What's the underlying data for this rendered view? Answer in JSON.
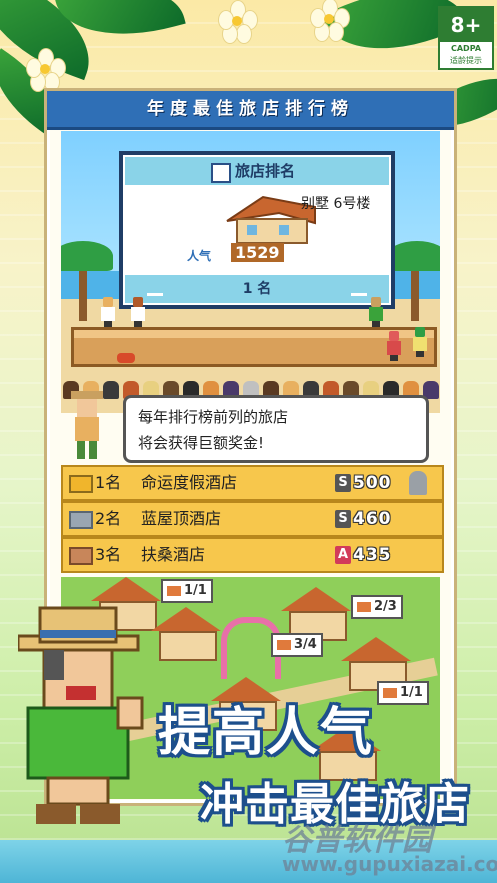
{
  "age_rating": {
    "value": "8+",
    "org": "CADPA",
    "caption": "适龄提示"
  },
  "panel": {
    "banner_title": "年度最佳旅店排行榜"
  },
  "billboard": {
    "title": "旅店排名",
    "hotel_name": "别墅 6号楼",
    "popularity_label": "人气",
    "popularity_value": "1529",
    "rank": "1 名"
  },
  "speech": {
    "line1": "每年排行榜前列的旅店",
    "line2": "将会获得巨额奖金!"
  },
  "rankings": [
    {
      "position": "1名",
      "name": "命运度假酒店",
      "grade": "S",
      "score": "500",
      "badge_color": "#f0b52c",
      "grade_color": "#555555"
    },
    {
      "position": "2名",
      "name": "蓝屋顶酒店",
      "grade": "S",
      "score": "460",
      "badge_color": "#9aa6b2",
      "grade_color": "#555555"
    },
    {
      "position": "3名",
      "name": "扶桑酒店",
      "grade": "A",
      "score": "435",
      "badge_color": "#c8865a",
      "grade_color": "#d23b5a"
    }
  ],
  "town_tags": [
    "1/1",
    "2/3",
    "3/4",
    "1/1"
  ],
  "headline": {
    "line1": "提高人气",
    "line2": "冲击最佳旅店"
  },
  "watermark": {
    "name": "谷普软件园",
    "url": "www.gupuxiazai.com"
  },
  "colors": {
    "banner": "#2f6fb6",
    "row": "#f7c74c",
    "outline": "#1d4f8c"
  }
}
